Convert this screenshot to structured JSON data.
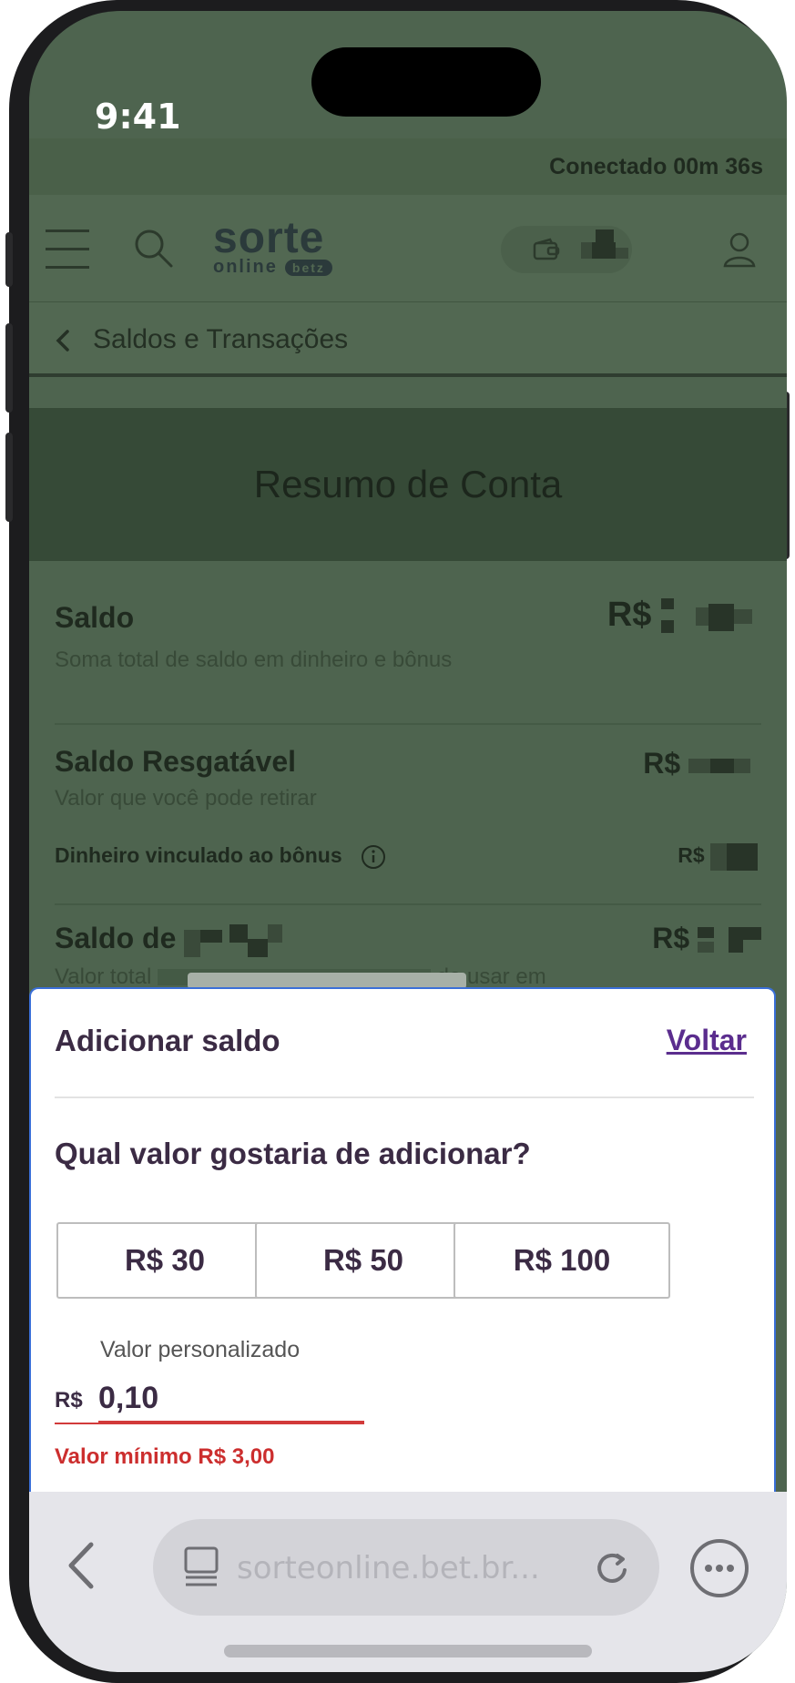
{
  "status_bar": {
    "time": "9:41"
  },
  "session": {
    "connected_text": "Conectado 00m 36s"
  },
  "header": {
    "logo_top": "sorte",
    "logo_bottom": "online",
    "logo_badge": "betz",
    "menu_icon": "hamburger-icon",
    "search_icon": "search-icon",
    "wallet_icon": "wallet-icon",
    "user_icon": "user-icon"
  },
  "breadcrumb": {
    "title": "Saldos e Transações"
  },
  "summary": {
    "title": "Resumo de Conta"
  },
  "rows": {
    "saldo": {
      "title": "Saldo",
      "subtitle": "Soma total de saldo em dinheiro e bônus",
      "currency": "R$"
    },
    "resgatavel": {
      "title": "Saldo Resgatável",
      "subtitle": "Valor que você pode retirar",
      "currency": "R$",
      "bonus_label": "Dinheiro vinculado ao bônus",
      "bonus_currency": "R$"
    },
    "saldo_de": {
      "title": "Saldo de",
      "subtitle_start": "Valor total",
      "subtitle_end": "de usar em",
      "currency": "R$"
    }
  },
  "sheet": {
    "title": "Adicionar saldo",
    "back_label": "Voltar",
    "question": "Qual valor gostaria de adicionar?",
    "amounts": [
      "R$ 30",
      "R$ 50",
      "R$ 100"
    ],
    "custom_label": "Valor personalizado",
    "custom_prefix": "R$",
    "custom_value": "0,10",
    "error": "Valor mínimo R$ 3,00"
  },
  "browser": {
    "url": "sorteonline.bet.br...",
    "back_icon": "chevron-left-icon",
    "tabs_icon": "tabs-icon",
    "reload_icon": "reload-icon",
    "more_icon": "more-icon"
  },
  "colors": {
    "overlay_green": "#4e644f",
    "accent_purple": "#5b2d8e",
    "error_red": "#cc2e2e",
    "sheet_border": "#3a6fd8"
  }
}
